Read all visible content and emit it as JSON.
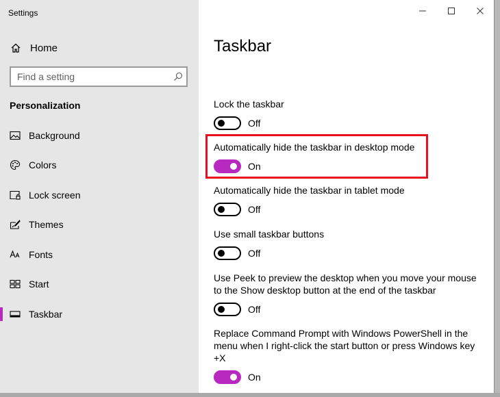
{
  "window": {
    "title": "Settings"
  },
  "colors": {
    "accent": "#b829c0",
    "highlight": "#e8101e",
    "sidebar_bg": "#e6e6e6"
  },
  "sidebar": {
    "home_label": "Home",
    "home_icon": "home-icon",
    "search": {
      "placeholder": "Find a setting",
      "value": "",
      "icon": "search-icon"
    },
    "section_heading": "Personalization",
    "items": [
      {
        "label": "Background",
        "icon": "picture-icon",
        "selected": false
      },
      {
        "label": "Colors",
        "icon": "palette-icon",
        "selected": false
      },
      {
        "label": "Lock screen",
        "icon": "lock-screen-icon",
        "selected": false
      },
      {
        "label": "Themes",
        "icon": "brush-icon",
        "selected": false
      },
      {
        "label": "Fonts",
        "icon": "font-icon",
        "selected": false
      },
      {
        "label": "Start",
        "icon": "start-tiles-icon",
        "selected": false
      },
      {
        "label": "Taskbar",
        "icon": "taskbar-icon",
        "selected": true
      }
    ]
  },
  "title_controls": [
    "minimize-icon",
    "maximize-icon",
    "close-icon"
  ],
  "main": {
    "title": "Taskbar",
    "settings": [
      {
        "label": "Lock the taskbar",
        "state": "Off",
        "on": false
      },
      {
        "label": "Automatically hide the taskbar in desktop mode",
        "state": "On",
        "on": true,
        "highlighted": true
      },
      {
        "label": "Automatically hide the taskbar in tablet mode",
        "state": "Off",
        "on": false
      },
      {
        "label": "Use small taskbar buttons",
        "state": "Off",
        "on": false
      },
      {
        "label": "Use Peek to preview the desktop when you move your mouse to the Show desktop button at the end of the taskbar",
        "state": "Off",
        "on": false
      },
      {
        "label": "Replace Command Prompt with Windows PowerShell in the menu when I right-click the start button or press Windows key +X",
        "state": "On",
        "on": true
      }
    ]
  }
}
